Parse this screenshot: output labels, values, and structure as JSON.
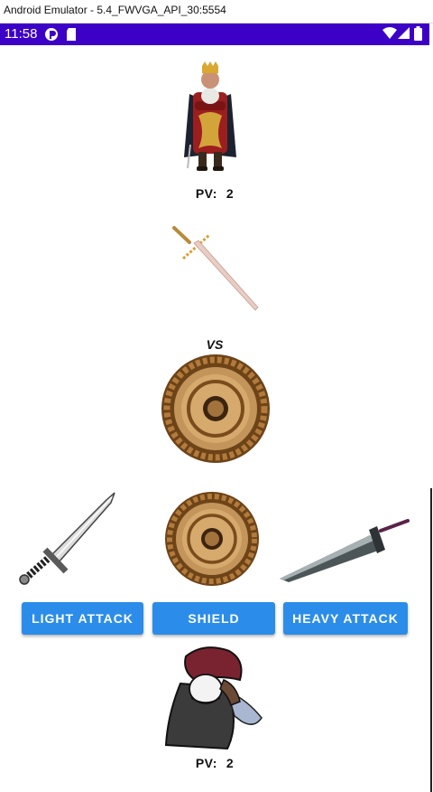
{
  "window": {
    "title": "Android Emulator - 5.4_FWVGA_API_30:5554"
  },
  "status_bar": {
    "time": "11:58",
    "background": "#3d00c7"
  },
  "enemy": {
    "pv_label": "PV:",
    "pv_value": "2",
    "icon": "king-character-icon"
  },
  "enemy_action": {
    "icon": "long-sword-icon"
  },
  "vs_label": "VS",
  "player_action": {
    "icon": "round-shield-icon"
  },
  "choices": {
    "light": {
      "icon": "short-sword-icon",
      "label": "LIGHT ATTACK"
    },
    "shield": {
      "icon": "round-shield-icon",
      "label": "SHIELD"
    },
    "heavy": {
      "icon": "buster-sword-icon",
      "label": "HEAVY ATTACK"
    }
  },
  "player": {
    "pv_label": "PV:",
    "pv_value": "2",
    "icon": "hooded-adventurer-icon"
  },
  "colors": {
    "button": "#2b8de9",
    "button_text": "#ffffff"
  }
}
